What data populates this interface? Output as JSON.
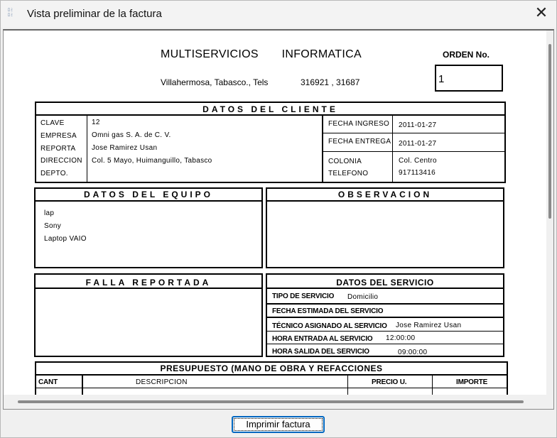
{
  "window": {
    "title": "Vista preliminar de la factura",
    "close_glyph": "✕",
    "icon_text": "ﾛﾐ\nﾛﾐ"
  },
  "company": {
    "name": "MULTISERVICIOS INFORMATICA",
    "address": "Villahermosa, Tabasco., Tels",
    "phones": "316921 , 31687"
  },
  "orden": {
    "label": "ORDEN No.",
    "value": "1"
  },
  "cliente": {
    "header": "DATOS DEL CLIENTE",
    "clave_label": "CLAVE",
    "clave": "12",
    "empresa_label": "EMPRESA",
    "empresa": "Omni gas S. A. de C. V.",
    "reporta_label": "REPORTA",
    "reporta": "Jose Ramirez Usan",
    "direccion_label": "DIRECCION",
    "direccion": "Col. 5 Mayo, Huimanguillo, Tabasco",
    "depto_label": "DEPTO.",
    "fecha_ingreso_label": "FECHA INGRESO",
    "fecha_ingreso": "2011-01-27",
    "fecha_entrega_label": "FECHA ENTREGA",
    "fecha_entrega": "2011-01-27",
    "colonia_label": "COLONIA",
    "colonia": "Col. Centro",
    "telefono_label": "TELEFONO",
    "telefono": "917113416"
  },
  "equipo": {
    "header": "DATOS DEL EQUIPO",
    "lines": [
      "lap",
      "Sony",
      "Laptop VAIO"
    ]
  },
  "observacion": {
    "header": "OBSERVACION"
  },
  "falla": {
    "header": "FALLA REPORTADA"
  },
  "servicio": {
    "header": "DATOS DEL SERVICIO",
    "tipo_label": "TIPO DE SERVICIO",
    "tipo": "Domicilio",
    "fecha_estimada_label": "FECHA ESTIMADA DEL SERVICIO",
    "tecnico_label": "TÉCNICO ASIGNADO AL SERVICIO",
    "tecnico": "Jose Ramirez Usan",
    "hora_entrada_label": "HORA ENTRADA AL SERVICIO",
    "hora_entrada": "12:00:00",
    "hora_salida_label": "HORA SALIDA DEL SERVICIO",
    "hora_salida": "09:00:00"
  },
  "presupuesto": {
    "header": "PRESUPUESTO (MANO DE OBRA Y REFACCIONES",
    "columns": [
      "CANT",
      "DESCRIPCION",
      "PRECIO U.",
      "IMPORTE"
    ]
  },
  "footer": {
    "print_label": "Imprimir factura"
  }
}
